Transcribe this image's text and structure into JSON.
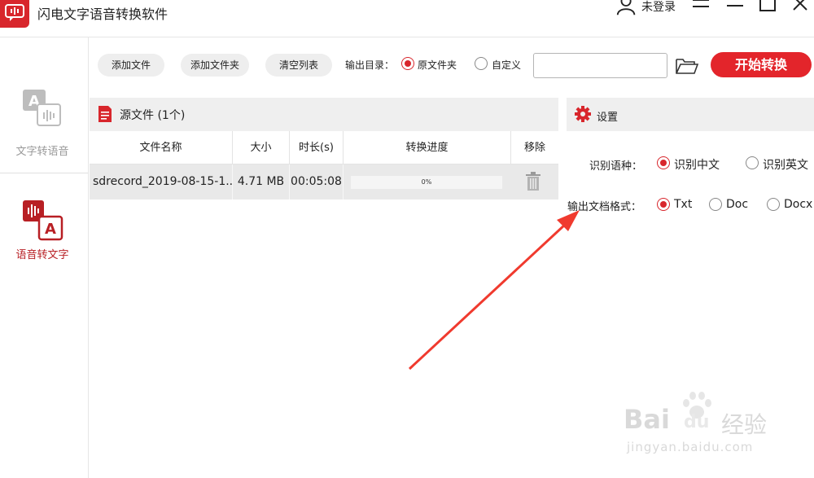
{
  "app": {
    "title": "闪电文字语音转换软件",
    "user_label": "未登录"
  },
  "sidebar": {
    "items": [
      {
        "label": "文字转语音",
        "icon": "text-to-speech-icon",
        "active": false
      },
      {
        "label": "语音转文字",
        "icon": "speech-to-text-icon",
        "active": true
      }
    ]
  },
  "toolbar": {
    "add_file": "添加文件",
    "add_folder": "添加文件夹",
    "clear_list": "清空列表",
    "output_dir_label": "输出目录：",
    "output_options": [
      {
        "label": "原文件夹",
        "selected": true
      },
      {
        "label": "自定义",
        "selected": false
      }
    ],
    "path_value": "",
    "start": "开始转换"
  },
  "source": {
    "title": "源文件 (1个)",
    "columns": [
      "文件名称",
      "大小",
      "时长(s)",
      "转换进度",
      "移除"
    ],
    "rows": [
      {
        "name": "sdrecord_2019-08-15-1...",
        "size": "4.71 MB",
        "duration": "00:05:08",
        "progress_text": "0%",
        "progress": 0
      }
    ]
  },
  "settings": {
    "title": "设置",
    "language_label": "识别语种：",
    "languages": [
      {
        "label": "识别中文",
        "selected": true
      },
      {
        "label": "识别英文",
        "selected": false
      }
    ],
    "format_label": "输出文档格式：",
    "formats": [
      {
        "label": "Txt",
        "selected": true
      },
      {
        "label": "Doc",
        "selected": false
      },
      {
        "label": "Docx",
        "selected": false
      }
    ]
  },
  "watermark": {
    "brand": "Bai",
    "brand2": "du",
    "cn": "经验",
    "url": "jingyan.baidu.com"
  },
  "colors": {
    "accent": "#e3252b",
    "brand_dark": "#b81f24",
    "header_bg": "#efefef"
  }
}
